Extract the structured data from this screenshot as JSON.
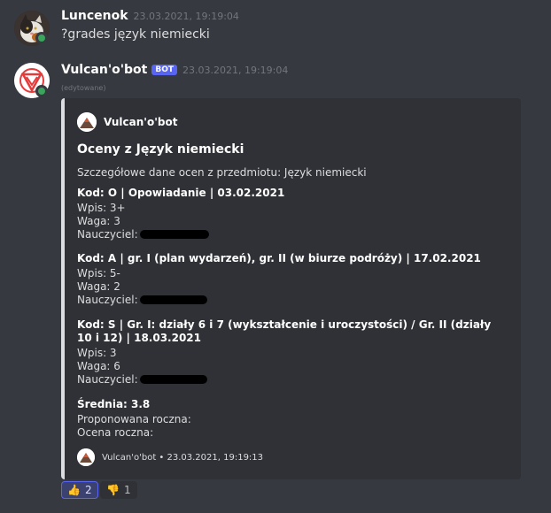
{
  "messages": [
    {
      "author": "Luncenok",
      "timestamp": "23.03.2021, 19:19:04",
      "text": "?grades język niemiecki"
    },
    {
      "author": "Vulcan'o'bot",
      "bot_tag": "BOT",
      "timestamp": "23.03.2021, 19:19:04",
      "edited": "(edytowane)"
    }
  ],
  "embed": {
    "author": "Vulcan'o'bot",
    "title": "Oceny z Język niemiecki",
    "description": "Szczegółowe dane ocen z przedmiotu: Język niemiecki",
    "grades": [
      {
        "header": "Kod: O | Opowiadanie | 03.02.2021",
        "wpis": "Wpis: 3+",
        "waga": "Waga: 3",
        "nauczyciel": "Nauczyciel:"
      },
      {
        "header": "Kod: A | gr. I (plan wydarzeń), gr. II (w biurze podróży) | 17.02.2021",
        "wpis": "Wpis: 5-",
        "waga": "Waga: 2",
        "nauczyciel": "Nauczyciel:"
      },
      {
        "header": "Kod: S | Gr. I: działy 6 i 7 (wykształcenie i uroczystości) / Gr. II (działy 10 i 12) | 18.03.2021",
        "wpis": "Wpis: 3",
        "waga": "Waga: 6",
        "nauczyciel": "Nauczyciel:"
      }
    ],
    "average": "Średnia: 3.8",
    "proposed": "Proponowana roczna:",
    "final": "Ocena roczna:",
    "footer": "Vulcan'o'bot • 23.03.2021, 19:19:13"
  },
  "reactions": [
    {
      "icon": "thumbs-up-icon",
      "emoji": "👍",
      "count": "2",
      "active": true
    },
    {
      "icon": "thumbs-down-icon",
      "emoji": "👎",
      "count": "1",
      "active": false
    }
  ],
  "colors": {
    "background": "#36393f",
    "embed_bg": "#2f3136",
    "online": "#3ba55d",
    "bot_tag": "#5865f2"
  }
}
